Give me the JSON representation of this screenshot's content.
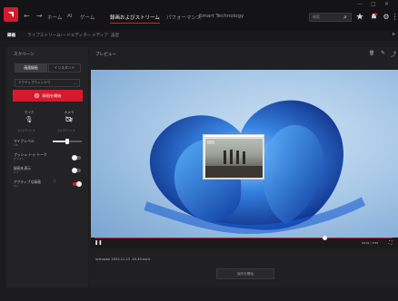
{
  "topbar": {
    "nav": [
      "ホーム",
      "AI",
      "ゲーム",
      "録画およびストリーム",
      "パフォーマンス",
      "Smart Technology"
    ],
    "active_index": 3,
    "search_placeholder": "検索",
    "window_buttons": [
      "—",
      "□",
      "✕"
    ]
  },
  "subnav": {
    "items": [
      "録画",
      "ライブストリーム",
      "ハードエディター",
      "メディア",
      "設定"
    ],
    "active_index": 0
  },
  "left": {
    "title": "スクリーン",
    "tabs": [
      "画面録画",
      "インスタント"
    ],
    "dropdown": "アクティブウィンドウ",
    "record_label": "録画を開始",
    "mic": {
      "label": "マイク",
      "sub": "マイクデバイス"
    },
    "camera": {
      "label": "カメラ",
      "sub": "カメラデバイス"
    },
    "rows": [
      {
        "label": "マイクレベル",
        "sub": "100"
      },
      {
        "label": "プッシュ トゥ トーク",
        "sub": "オフ/オン"
      },
      {
        "label": "録画を表示",
        "sub": "オフ"
      },
      {
        "label": "アクティブな録画",
        "sub": "オン"
      }
    ]
  },
  "right": {
    "title": "プレビュー",
    "file_name": "unknown 2025.11.13 -20.40.mp4",
    "bottom_button": "保存を開始",
    "time": "00:21 / 3:55"
  },
  "colors": {
    "accent": "#d7192d",
    "bg": "#1c1c1e",
    "panel": "#232326"
  }
}
